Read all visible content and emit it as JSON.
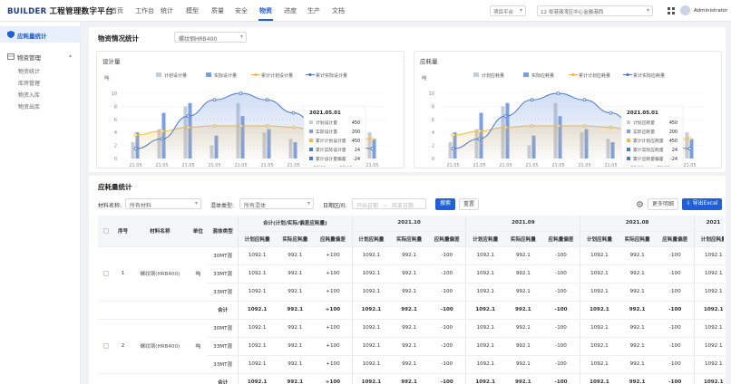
{
  "header": {
    "logo": "BUILDER",
    "platform_title": "工程管理数字平台",
    "nav": [
      "首页",
      "工作台",
      "统计",
      "模型",
      "质量",
      "安全",
      "物资",
      "进度",
      "生产",
      "文档"
    ],
    "active_nav": "物资",
    "project_select": "项目平台",
    "project_select2": "12 粤港澳湾区中心金融港西",
    "user_name": "Administrator"
  },
  "sidebar": {
    "active_item": "应耗量统计",
    "group": "物资管理",
    "items": [
      "物资统计",
      "库房管理",
      "物资入库",
      "物资出库"
    ]
  },
  "page": {
    "title": "物资情况统计",
    "material_select": "螺纹钢HRB400"
  },
  "chart_data": [
    {
      "type": "bar",
      "title": "设计量",
      "unit_label": "吨",
      "legend": [
        "计划设计量",
        "实际设计量",
        "累计计划设计量",
        "累计实际设计量"
      ],
      "categories": [
        "21.05",
        "21.05",
        "21.05",
        "21.05",
        "21.05",
        "21.05",
        "21.05",
        "21.05",
        "21.05",
        "21.05"
      ],
      "ylim": [
        0,
        10
      ],
      "yticks": [
        0,
        2,
        4,
        6,
        8,
        10
      ],
      "series": [
        {
          "name": "计划设计量",
          "values": [
            2.5,
            4.5,
            8,
            2,
            8.5,
            4,
            3,
            2.5,
            3,
            4
          ]
        },
        {
          "name": "实际设计量",
          "values": [
            4,
            7,
            8.5,
            3.5,
            6.5,
            4.5,
            2.5,
            2,
            4,
            3
          ]
        },
        {
          "name": "累计计划设计量",
          "values": [
            3.6,
            4.2,
            4.8,
            5.0,
            5.0,
            5.0,
            4.8,
            4.0,
            3.5,
            3.0
          ]
        },
        {
          "name": "累计实际设计量",
          "values": [
            1.5,
            3,
            6.5,
            9,
            10,
            9,
            7,
            4.5,
            2.5,
            1.5
          ]
        }
      ],
      "tooltip": {
        "date": "2021.05.01",
        "rows": [
          {
            "label": "计划设计量",
            "value": "450"
          },
          {
            "label": "实际设计量",
            "value": "200"
          },
          {
            "label": "累计计划设计量",
            "value": "450"
          },
          {
            "label": "累计实际设计量",
            "value": "24"
          },
          {
            "label": "累计设计量偏差",
            "value": "-24"
          }
        ]
      }
    },
    {
      "type": "bar",
      "title": "应耗量",
      "unit_label": "吨",
      "legend": [
        "计划应耗量",
        "实际应耗量",
        "累计计划应耗量",
        "累计实际应耗量"
      ],
      "categories": [
        "21.05",
        "21.05",
        "21.05",
        "21.05",
        "21.05",
        "21.05",
        "21.05",
        "21.05",
        "21.05",
        "21.05"
      ],
      "ylim": [
        0,
        10
      ],
      "yticks": [
        0,
        2,
        4,
        6,
        8,
        10
      ],
      "series": [
        {
          "name": "计划应耗量",
          "values": [
            2.5,
            4.5,
            8,
            2,
            8.5,
            4,
            3,
            2.5,
            3,
            4
          ]
        },
        {
          "name": "实际应耗量",
          "values": [
            4,
            7,
            8.5,
            3.5,
            6.5,
            4.5,
            2.5,
            2,
            4,
            3
          ]
        },
        {
          "name": "累计计划应耗量",
          "values": [
            3.6,
            4.2,
            4.8,
            5.0,
            5.0,
            5.0,
            4.8,
            4.0,
            3.5,
            3.0
          ]
        },
        {
          "name": "累计实际应耗量",
          "values": [
            1.5,
            3,
            6.5,
            9,
            10,
            9,
            7,
            4.5,
            2.5,
            1.5
          ]
        }
      ],
      "tooltip": {
        "date": "2021.05.01",
        "rows": [
          {
            "label": "计划应耗量",
            "value": "450"
          },
          {
            "label": "实际应耗量",
            "value": "200"
          },
          {
            "label": "累计计划应耗量",
            "value": "450"
          },
          {
            "label": "累计实际应耗量",
            "value": "24"
          },
          {
            "label": "累计应耗量偏差",
            "value": "-24"
          }
        ]
      }
    }
  ],
  "table_section": {
    "title": "应耗量统计",
    "filter_material_label": "材料名称:",
    "filter_material_value": "所有材料",
    "filter_type_label": "混体类型:",
    "filter_type_value": "所有混体",
    "filter_date_label": "日期区间:",
    "date_start_placeholder": "开始日期",
    "date_end_placeholder": "结束日期",
    "search_btn": "搜索",
    "reset_btn": "重置",
    "more_btn": "更多明细",
    "export_btn": "导出Excel",
    "headers": {
      "no": "序号",
      "material": "材料名称",
      "unit": "单位",
      "type": "混体类型",
      "group0": "合计(计划/实际/偏差应耗量)",
      "groups": [
        "2021.10",
        "2021.09",
        "2021.08",
        "2021"
      ],
      "sub": [
        "计划应耗量",
        "实际应耗量",
        "应耗量偏差"
      ]
    },
    "rows": [
      {
        "no": "1",
        "material": "螺纹钢(HRB400)",
        "unit": "吨",
        "subrows": [
          {
            "type": "30MT混",
            "total": [
              "1092.1",
              "992.1",
              "+100"
            ],
            "m": [
              "1092.1",
              "992.1",
              "-100",
              "1092.1",
              "992.1",
              "-100",
              "1092.1",
              "992.1",
              "-100",
              "1092.1"
            ]
          },
          {
            "type": "33MT混",
            "total": [
              "1092.1",
              "992.1",
              "+100"
            ],
            "m": [
              "1092.1",
              "992.1",
              "-100",
              "1092.1",
              "992.1",
              "-100",
              "1092.1",
              "992.1",
              "-100",
              "1092.1"
            ]
          },
          {
            "type": "33MT混",
            "total": [
              "1092.1",
              "992.1",
              "+100"
            ],
            "m": [
              "1092.1",
              "992.1",
              "-100",
              "1092.1",
              "992.1",
              "-100",
              "1092.1",
              "992.1",
              "-100",
              "1092.1"
            ]
          }
        ],
        "sum": {
          "type": "合计",
          "total": [
            "1092.1",
            "992.1",
            "+100"
          ],
          "m": [
            "1092.1",
            "992.1",
            "-100",
            "1092.1",
            "992.1",
            "-100",
            "1092.1",
            "992.1",
            "-100",
            "1092.1"
          ]
        }
      },
      {
        "no": "2",
        "material": "螺纹钢(HRB400)",
        "unit": "吨",
        "subrows": [
          {
            "type": "30MT混",
            "total": [
              "1092.1",
              "992.1",
              "+100"
            ],
            "m": [
              "1092.1",
              "992.1",
              "-100",
              "1092.1",
              "992.1",
              "-100",
              "1092.1",
              "992.1",
              "-100",
              "1092.1"
            ]
          },
          {
            "type": "33MT混",
            "total": [
              "1092.1",
              "992.1",
              "+100"
            ],
            "m": [
              "1092.1",
              "992.1",
              "-100",
              "1092.1",
              "992.1",
              "-100",
              "1092.1",
              "992.1",
              "-100",
              "1092.1"
            ]
          },
          {
            "type": "33MT混",
            "total": [
              "1092.1",
              "992.1",
              "+100"
            ],
            "m": [
              "1092.1",
              "992.1",
              "-100",
              "1092.1",
              "992.1",
              "-100",
              "1092.1",
              "992.1",
              "-100",
              "1092.1"
            ]
          }
        ],
        "sum": {
          "type": "合计",
          "total": [
            "1092.1",
            "992.1",
            "+100"
          ],
          "m": [
            "1092.1",
            "992.1",
            "-100",
            "1092.1",
            "992.1",
            "-100",
            "1092.1",
            "992.1",
            "-100",
            "1092.1"
          ]
        }
      }
    ]
  }
}
